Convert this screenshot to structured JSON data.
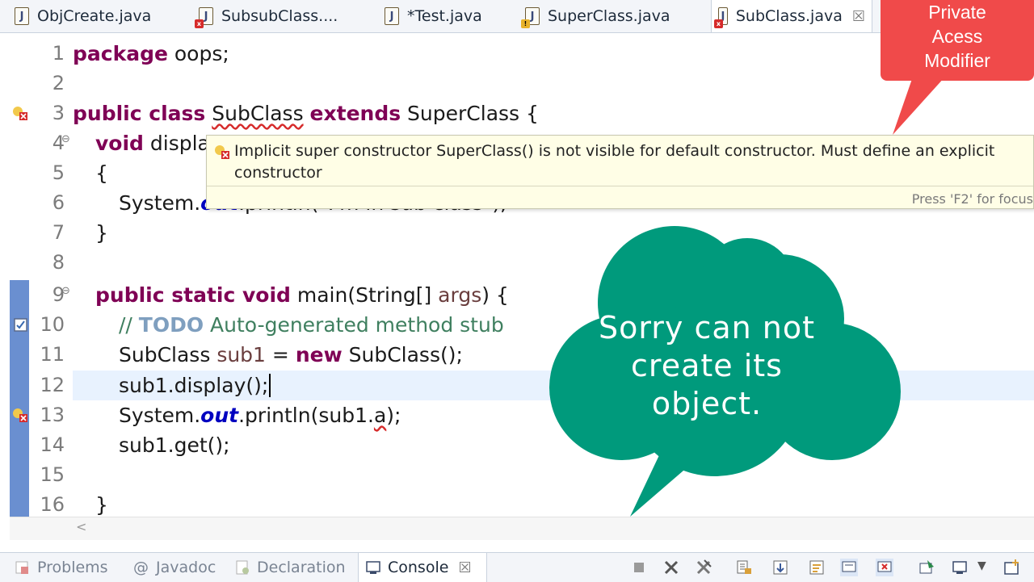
{
  "tabs": [
    {
      "label": "ObjCreate.java",
      "badge": "none",
      "active": false
    },
    {
      "label": "SubsubClass....",
      "badge": "error",
      "active": false
    },
    {
      "label": "*Test.java",
      "badge": "none",
      "active": false
    },
    {
      "label": "SuperClass.java",
      "badge": "warning",
      "active": false
    },
    {
      "label": "SubClass.java",
      "badge": "error",
      "active": true
    }
  ],
  "tab_close_glyph": "☒",
  "callout_red": {
    "lines": [
      "Private",
      "Acess",
      "Modifier"
    ],
    "color": "#f04a4a"
  },
  "callout_cloud": {
    "lines": [
      "Sorry can not",
      "create its",
      "object."
    ],
    "color": "#009a7c"
  },
  "tooltip": {
    "message": "Implicit super constructor SuperClass() is not visible for default constructor. Must define an explicit constructor",
    "hint": "Press 'F2' for focus"
  },
  "code": {
    "line_numbers": [
      "1",
      "2",
      "3",
      "4",
      "5",
      "6",
      "7",
      "8",
      "9",
      "10",
      "11",
      "12",
      "13",
      "14",
      "15",
      "16"
    ],
    "l1_kw": "package",
    "l1_rest": " oops;",
    "l3_kw": "public class",
    "l3_cls": "SubClass",
    "l3_kw2": "extends",
    "l3_rest": " SuperClass {",
    "l4_kw": "void",
    "l4_rest": " displa",
    "l5": "{",
    "l6_a": "System.",
    "l6_b": "out",
    "l6_c": ".println(\"I'm in sub class\");",
    "l7": "}",
    "l9_kw": "public static void",
    "l9_a": " main(String[] ",
    "l9_var": "args",
    "l9_b": ") {",
    "l10_a": "// ",
    "l10_todo": "TODO",
    "l10_b": " Auto-generated method stub",
    "l11_a": "SubClass ",
    "l11_var": "sub1",
    "l11_b": " = ",
    "l11_kw": "new",
    "l11_c": " SubClass();",
    "l12": "sub1.display();",
    "l13_a": "System.",
    "l13_out": "out",
    "l13_b": ".println(sub1.",
    "l13_err": "a",
    "l13_c": ");",
    "l14": "sub1.get();",
    "l16": "}"
  },
  "bottom_tabs": [
    {
      "label": "Problems",
      "icon": "problems-icon",
      "active": false
    },
    {
      "label": "Javadoc",
      "icon": "at-icon",
      "active": false
    },
    {
      "label": "Declaration",
      "icon": "declaration-icon",
      "active": false
    },
    {
      "label": "Console",
      "icon": "console-icon",
      "active": true
    }
  ],
  "console_tools": [
    "terminate-icon",
    "remove-launch-icon",
    "remove-all-icon",
    "clear-console-icon",
    "scroll-lock-icon",
    "word-wrap-icon",
    "show-on-output-icon",
    "show-on-error-icon",
    "pin-console-icon",
    "display-console-icon",
    "open-console-icon"
  ],
  "colors": {
    "keyword": "#7f0055",
    "comment": "#3f7f5f",
    "field": "#0000c0",
    "error": "#d62b2b"
  }
}
